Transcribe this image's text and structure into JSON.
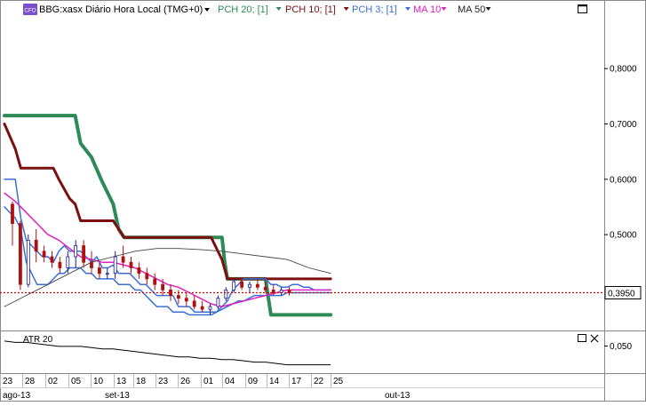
{
  "header": {
    "badge": "CFD",
    "symbol": "BBG:xasx Diário Hora Local (TMG+0)",
    "indicators": [
      {
        "label": "PCH 20; [1]",
        "color": "#2e8b57"
      },
      {
        "label": "PCH 10; [1]",
        "color": "#7b1010"
      },
      {
        "label": "PCH 3; [1]",
        "color": "#3a6fd8"
      },
      {
        "label": "MA 10",
        "color": "#e020c0"
      },
      {
        "label": "MA 50",
        "color": "#222222"
      }
    ]
  },
  "sub_panel": {
    "label": "ATR 20",
    "tick": "0,050"
  },
  "chart_data": {
    "type": "line",
    "y_axis": {
      "ticks": [
        0.8,
        0.7,
        0.6,
        0.5
      ],
      "tick_labels": [
        "0,8000",
        "0,7000",
        "0,6000",
        "0,5000"
      ],
      "range": [
        0.33,
        0.895
      ]
    },
    "current_price": {
      "value": 0.395,
      "label": "0,3950",
      "color": "#cc0000"
    },
    "x_day_labels": [
      "23",
      "28",
      "02",
      "05",
      "10",
      "13",
      "18",
      "23",
      "26",
      "01",
      "04",
      "09",
      "14",
      "17",
      "22",
      "25"
    ],
    "x_month_labels": [
      "ago-13",
      "set-13",
      "out-13"
    ],
    "candles": [
      {
        "o": 0.555,
        "h": 0.56,
        "l": 0.48,
        "c": 0.52
      },
      {
        "o": 0.52,
        "h": 0.525,
        "l": 0.4,
        "c": 0.41
      },
      {
        "o": 0.41,
        "h": 0.5,
        "l": 0.405,
        "c": 0.49
      },
      {
        "o": 0.49,
        "h": 0.51,
        "l": 0.45,
        "c": 0.47
      },
      {
        "o": 0.47,
        "h": 0.48,
        "l": 0.45,
        "c": 0.46
      },
      {
        "o": 0.46,
        "h": 0.47,
        "l": 0.44,
        "c": 0.45
      },
      {
        "o": 0.45,
        "h": 0.46,
        "l": 0.43,
        "c": 0.44
      },
      {
        "o": 0.44,
        "h": 0.47,
        "l": 0.43,
        "c": 0.46
      },
      {
        "o": 0.46,
        "h": 0.49,
        "l": 0.44,
        "c": 0.48
      },
      {
        "o": 0.48,
        "h": 0.49,
        "l": 0.44,
        "c": 0.45
      },
      {
        "o": 0.45,
        "h": 0.47,
        "l": 0.43,
        "c": 0.44
      },
      {
        "o": 0.44,
        "h": 0.45,
        "l": 0.42,
        "c": 0.43
      },
      {
        "o": 0.43,
        "h": 0.44,
        "l": 0.42,
        "c": 0.43
      },
      {
        "o": 0.43,
        "h": 0.47,
        "l": 0.42,
        "c": 0.46
      },
      {
        "o": 0.46,
        "h": 0.48,
        "l": 0.44,
        "c": 0.45
      },
      {
        "o": 0.45,
        "h": 0.46,
        "l": 0.43,
        "c": 0.44
      },
      {
        "o": 0.44,
        "h": 0.45,
        "l": 0.42,
        "c": 0.43
      },
      {
        "o": 0.43,
        "h": 0.44,
        "l": 0.41,
        "c": 0.42
      },
      {
        "o": 0.42,
        "h": 0.43,
        "l": 0.4,
        "c": 0.41
      },
      {
        "o": 0.41,
        "h": 0.42,
        "l": 0.39,
        "c": 0.4
      },
      {
        "o": 0.4,
        "h": 0.41,
        "l": 0.38,
        "c": 0.39
      },
      {
        "o": 0.39,
        "h": 0.4,
        "l": 0.375,
        "c": 0.385
      },
      {
        "o": 0.385,
        "h": 0.395,
        "l": 0.37,
        "c": 0.38
      },
      {
        "o": 0.38,
        "h": 0.39,
        "l": 0.365,
        "c": 0.37
      },
      {
        "o": 0.37,
        "h": 0.38,
        "l": 0.36,
        "c": 0.365
      },
      {
        "o": 0.365,
        "h": 0.375,
        "l": 0.355,
        "c": 0.37
      },
      {
        "o": 0.37,
        "h": 0.39,
        "l": 0.365,
        "c": 0.385
      },
      {
        "o": 0.385,
        "h": 0.405,
        "l": 0.38,
        "c": 0.4
      },
      {
        "o": 0.4,
        "h": 0.42,
        "l": 0.395,
        "c": 0.415
      },
      {
        "o": 0.415,
        "h": 0.42,
        "l": 0.4,
        "c": 0.405
      },
      {
        "o": 0.405,
        "h": 0.415,
        "l": 0.395,
        "c": 0.41
      },
      {
        "o": 0.41,
        "h": 0.42,
        "l": 0.4,
        "c": 0.405
      },
      {
        "o": 0.405,
        "h": 0.415,
        "l": 0.395,
        "c": 0.4
      },
      {
        "o": 0.4,
        "h": 0.41,
        "l": 0.39,
        "c": 0.395
      },
      {
        "o": 0.395,
        "h": 0.405,
        "l": 0.39,
        "c": 0.4
      },
      {
        "o": 0.4,
        "h": 0.405,
        "l": 0.39,
        "c": 0.395
      }
    ],
    "series": [
      {
        "name": "PCH 20; [1]",
        "color": "#2e8b57",
        "width": 4,
        "points": [
          [
            0,
            0.715
          ],
          [
            13,
            0.715
          ],
          [
            14,
            0.665
          ],
          [
            16,
            0.64
          ],
          [
            18,
            0.595
          ],
          [
            20,
            0.555
          ],
          [
            21,
            0.51
          ],
          [
            22,
            0.495
          ],
          [
            23,
            0.495
          ],
          [
            31,
            0.495
          ],
          [
            33,
            0.495
          ],
          [
            35,
            0.495
          ],
          [
            36,
            0.495
          ],
          [
            38,
            0.495
          ],
          [
            40,
            0.495
          ],
          [
            40.5,
            0.45
          ],
          [
            41,
            0.42
          ],
          [
            48,
            0.42
          ],
          [
            49,
            0.355
          ],
          [
            50,
            0.355
          ],
          [
            53,
            0.355
          ],
          [
            56,
            0.355
          ],
          [
            58,
            0.355
          ],
          [
            60,
            0.355
          ]
        ]
      },
      {
        "name": "PCH 10; [1]",
        "color": "#7b1010",
        "width": 3,
        "points": [
          [
            0,
            0.7
          ],
          [
            2,
            0.655
          ],
          [
            3,
            0.62
          ],
          [
            9,
            0.62
          ],
          [
            10,
            0.6
          ],
          [
            12,
            0.565
          ],
          [
            13,
            0.555
          ],
          [
            14,
            0.525
          ],
          [
            20,
            0.525
          ],
          [
            22,
            0.495
          ],
          [
            23,
            0.495
          ],
          [
            36,
            0.495
          ],
          [
            38,
            0.495
          ],
          [
            40,
            0.455
          ],
          [
            41,
            0.42
          ],
          [
            44,
            0.42
          ],
          [
            48,
            0.42
          ],
          [
            50,
            0.42
          ],
          [
            51,
            0.42
          ],
          [
            53,
            0.42
          ],
          [
            56,
            0.42
          ],
          [
            58,
            0.42
          ],
          [
            60,
            0.42
          ]
        ]
      },
      {
        "name": "PCH 3; [1]",
        "color": "#3a6fd8",
        "width": 1.5,
        "points": [
          [
            0,
            0.6
          ],
          [
            2,
            0.6
          ],
          [
            3,
            0.53
          ],
          [
            4,
            0.49
          ],
          [
            5,
            0.48
          ],
          [
            6,
            0.47
          ],
          [
            7,
            0.46
          ],
          [
            8,
            0.46
          ],
          [
            9,
            0.45
          ],
          [
            10,
            0.47
          ],
          [
            11,
            0.48
          ],
          [
            12,
            0.47
          ],
          [
            13,
            0.47
          ],
          [
            14,
            0.47
          ],
          [
            15,
            0.46
          ],
          [
            16,
            0.45
          ],
          [
            17,
            0.46
          ],
          [
            18,
            0.44
          ],
          [
            19,
            0.44
          ],
          [
            20,
            0.445
          ],
          [
            21,
            0.43
          ],
          [
            22,
            0.43
          ],
          [
            23,
            0.43
          ],
          [
            24,
            0.42
          ],
          [
            25,
            0.41
          ],
          [
            26,
            0.41
          ],
          [
            27,
            0.4
          ],
          [
            28,
            0.39
          ],
          [
            29,
            0.39
          ],
          [
            30,
            0.39
          ],
          [
            31,
            0.39
          ],
          [
            32,
            0.37
          ],
          [
            33,
            0.37
          ],
          [
            34,
            0.37
          ],
          [
            35,
            0.36
          ],
          [
            36,
            0.36
          ],
          [
            37,
            0.36
          ],
          [
            38,
            0.36
          ],
          [
            39,
            0.36
          ],
          [
            40,
            0.37
          ],
          [
            41,
            0.38
          ],
          [
            42,
            0.4
          ],
          [
            43,
            0.41
          ],
          [
            44,
            0.42
          ],
          [
            45,
            0.42
          ],
          [
            46,
            0.42
          ],
          [
            47,
            0.42
          ],
          [
            48,
            0.42
          ],
          [
            49,
            0.41
          ],
          [
            50,
            0.41
          ],
          [
            51,
            0.405
          ],
          [
            52,
            0.405
          ],
          [
            53,
            0.41
          ],
          [
            54,
            0.41
          ],
          [
            55,
            0.405
          ],
          [
            56,
            0.405
          ],
          [
            57,
            0.4
          ],
          [
            58,
            0.4
          ],
          [
            59,
            0.4
          ],
          [
            60,
            0.4
          ]
        ]
      },
      {
        "name": "PCH 3; [1] lower",
        "color": "#3a6fd8",
        "width": 1.5,
        "points": [
          [
            0,
            0.55
          ],
          [
            2,
            0.53
          ],
          [
            3,
            0.51
          ],
          [
            4,
            0.45
          ],
          [
            5,
            0.43
          ],
          [
            6,
            0.41
          ],
          [
            7,
            0.41
          ],
          [
            8,
            0.41
          ],
          [
            9,
            0.42
          ],
          [
            10,
            0.43
          ],
          [
            11,
            0.43
          ],
          [
            12,
            0.44
          ],
          [
            13,
            0.44
          ],
          [
            14,
            0.44
          ],
          [
            15,
            0.43
          ],
          [
            16,
            0.43
          ],
          [
            17,
            0.42
          ],
          [
            18,
            0.42
          ],
          [
            19,
            0.42
          ],
          [
            20,
            0.42
          ],
          [
            21,
            0.41
          ],
          [
            22,
            0.41
          ],
          [
            23,
            0.41
          ],
          [
            24,
            0.4
          ],
          [
            25,
            0.4
          ],
          [
            26,
            0.39
          ],
          [
            27,
            0.38
          ],
          [
            28,
            0.37
          ],
          [
            29,
            0.37
          ],
          [
            30,
            0.37
          ],
          [
            31,
            0.36
          ],
          [
            32,
            0.36
          ],
          [
            33,
            0.36
          ],
          [
            34,
            0.355
          ],
          [
            35,
            0.355
          ],
          [
            36,
            0.355
          ],
          [
            37,
            0.355
          ],
          [
            38,
            0.355
          ],
          [
            39,
            0.36
          ],
          [
            40,
            0.365
          ],
          [
            41,
            0.37
          ],
          [
            42,
            0.375
          ],
          [
            43,
            0.38
          ],
          [
            44,
            0.38
          ],
          [
            45,
            0.385
          ],
          [
            46,
            0.39
          ],
          [
            47,
            0.39
          ],
          [
            48,
            0.39
          ],
          [
            49,
            0.39
          ],
          [
            50,
            0.39
          ],
          [
            51,
            0.39
          ],
          [
            52,
            0.395
          ],
          [
            53,
            0.395
          ],
          [
            54,
            0.395
          ],
          [
            55,
            0.395
          ],
          [
            56,
            0.395
          ],
          [
            57,
            0.395
          ],
          [
            58,
            0.395
          ],
          [
            59,
            0.395
          ],
          [
            60,
            0.395
          ]
        ]
      },
      {
        "name": "MA 10",
        "color": "#e020c0",
        "width": 1.5,
        "points": [
          [
            0,
            0.575
          ],
          [
            2,
            0.56
          ],
          [
            4,
            0.54
          ],
          [
            6,
            0.52
          ],
          [
            8,
            0.5
          ],
          [
            10,
            0.49
          ],
          [
            12,
            0.475
          ],
          [
            14,
            0.46
          ],
          [
            16,
            0.455
          ],
          [
            18,
            0.45
          ],
          [
            20,
            0.45
          ],
          [
            22,
            0.445
          ],
          [
            24,
            0.44
          ],
          [
            26,
            0.43
          ],
          [
            28,
            0.42
          ],
          [
            30,
            0.41
          ],
          [
            32,
            0.405
          ],
          [
            34,
            0.395
          ],
          [
            36,
            0.385
          ],
          [
            38,
            0.375
          ],
          [
            40,
            0.37
          ],
          [
            42,
            0.375
          ],
          [
            44,
            0.38
          ],
          [
            46,
            0.385
          ],
          [
            48,
            0.39
          ],
          [
            50,
            0.395
          ],
          [
            52,
            0.4
          ],
          [
            54,
            0.4
          ],
          [
            56,
            0.4
          ],
          [
            58,
            0.4
          ],
          [
            60,
            0.4
          ]
        ]
      },
      {
        "name": "MA 50",
        "color": "#444444",
        "width": 0.9,
        "points": [
          [
            0,
            0.37
          ],
          [
            4,
            0.39
          ],
          [
            8,
            0.41
          ],
          [
            12,
            0.43
          ],
          [
            16,
            0.45
          ],
          [
            20,
            0.46
          ],
          [
            24,
            0.47
          ],
          [
            28,
            0.475
          ],
          [
            32,
            0.475
          ],
          [
            36,
            0.473
          ],
          [
            40,
            0.47
          ],
          [
            44,
            0.465
          ],
          [
            48,
            0.46
          ],
          [
            52,
            0.455
          ],
          [
            56,
            0.44
          ],
          [
            60,
            0.43
          ]
        ]
      }
    ],
    "atr": {
      "color": "#000000",
      "points": [
        [
          0,
          0.058
        ],
        [
          2,
          0.057
        ],
        [
          4,
          0.057
        ],
        [
          6,
          0.056
        ],
        [
          8,
          0.055
        ],
        [
          10,
          0.054
        ],
        [
          12,
          0.054
        ],
        [
          14,
          0.054
        ],
        [
          16,
          0.053
        ],
        [
          18,
          0.052
        ],
        [
          20,
          0.052
        ],
        [
          22,
          0.051
        ],
        [
          24,
          0.05
        ],
        [
          26,
          0.049
        ],
        [
          28,
          0.048
        ],
        [
          30,
          0.047
        ],
        [
          32,
          0.046
        ],
        [
          34,
          0.046
        ],
        [
          36,
          0.045
        ],
        [
          38,
          0.045
        ],
        [
          40,
          0.044
        ],
        [
          42,
          0.044
        ],
        [
          44,
          0.043
        ],
        [
          46,
          0.042
        ],
        [
          48,
          0.042
        ],
        [
          50,
          0.041
        ],
        [
          52,
          0.04
        ],
        [
          54,
          0.04
        ],
        [
          56,
          0.04
        ],
        [
          58,
          0.04
        ],
        [
          60,
          0.04
        ]
      ]
    }
  }
}
